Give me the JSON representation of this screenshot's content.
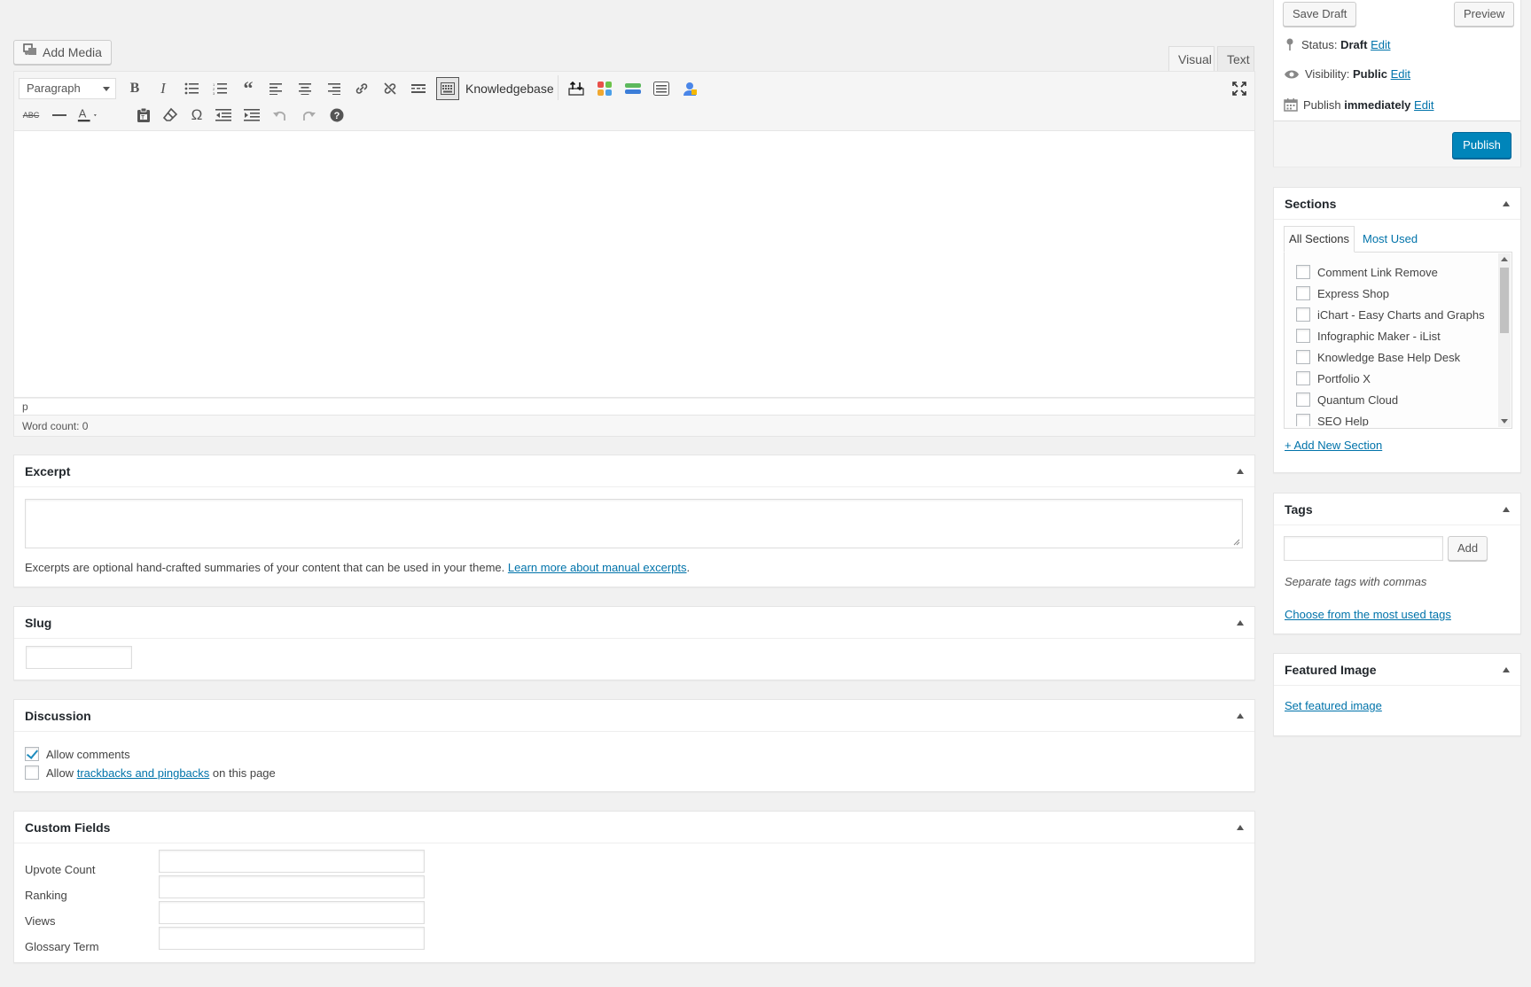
{
  "editor": {
    "add_media_label": "Add Media",
    "tab_visual": "Visual",
    "tab_text": "Text",
    "format_select": "Paragraph",
    "knowledgebase_label": "Knowledgebase",
    "path_label": "p",
    "word_count": "Word count: 0",
    "icons_row1": [
      "bold-icon",
      "italic-icon",
      "bullet-list-icon",
      "numbered-list-icon",
      "blockquote-icon",
      "align-left-icon",
      "align-center-icon",
      "align-right-icon",
      "link-icon",
      "unlink-icon",
      "read-more-icon",
      "toolbar-toggle-icon"
    ],
    "icons_row1b": [
      "shortcode-up-icon",
      "color-grid-icon",
      "bar-icon",
      "list-block-icon",
      "user-lock-icon"
    ],
    "icons_row2": [
      "strikethrough-icon",
      "horizontal-line-icon",
      "text-color-icon",
      "paste-text-icon",
      "clear-format-icon",
      "omega-icon",
      "outdent-icon",
      "indent-icon",
      "undo-icon",
      "redo-icon",
      "help-icon"
    ]
  },
  "excerpt": {
    "title": "Excerpt",
    "help_text": "Excerpts are optional hand-crafted summaries of your content that can be used in your theme.",
    "help_link": "Learn more about manual excerpts",
    "help_end": "."
  },
  "slug": {
    "title": "Slug",
    "value": ""
  },
  "discussion": {
    "title": "Discussion",
    "allow_comments": "Allow comments",
    "allow_comments_checked": true,
    "allow_trackbacks_prefix": "Allow",
    "allow_trackbacks_link": "trackbacks and pingbacks",
    "allow_trackbacks_suffix": "on this page",
    "allow_trackbacks_checked": false
  },
  "custom_fields": {
    "title": "Custom Fields",
    "fields": [
      {
        "label": "Upvote Count",
        "value": ""
      },
      {
        "label": "Ranking",
        "value": ""
      },
      {
        "label": "Views",
        "value": ""
      },
      {
        "label": "Glossary Term",
        "value": ""
      }
    ]
  },
  "publish": {
    "save_draft": "Save Draft",
    "preview": "Preview",
    "status_label": "Status:",
    "status_value": "Draft",
    "visibility_label": "Visibility:",
    "visibility_value": "Public",
    "publish_label": "Publish",
    "publish_value": "immediately",
    "edit": "Edit",
    "publish_button": "Publish",
    "accent_color": "#0085ba"
  },
  "sections": {
    "title": "Sections",
    "tab_all": "All Sections",
    "tab_most": "Most Used",
    "items": [
      "Comment Link Remove",
      "Express Shop",
      "iChart - Easy Charts and Graphs",
      "Infographic Maker - iList",
      "Knowledge Base Help Desk",
      "Portfolio X",
      "Quantum Cloud",
      "SEO Help"
    ],
    "add_new": "+ Add New Section"
  },
  "tags": {
    "title": "Tags",
    "add_button": "Add",
    "hint": "Separate tags with commas",
    "choose_link": "Choose from the most used tags"
  },
  "featured_image": {
    "title": "Featured Image",
    "set_link": "Set featured image"
  }
}
